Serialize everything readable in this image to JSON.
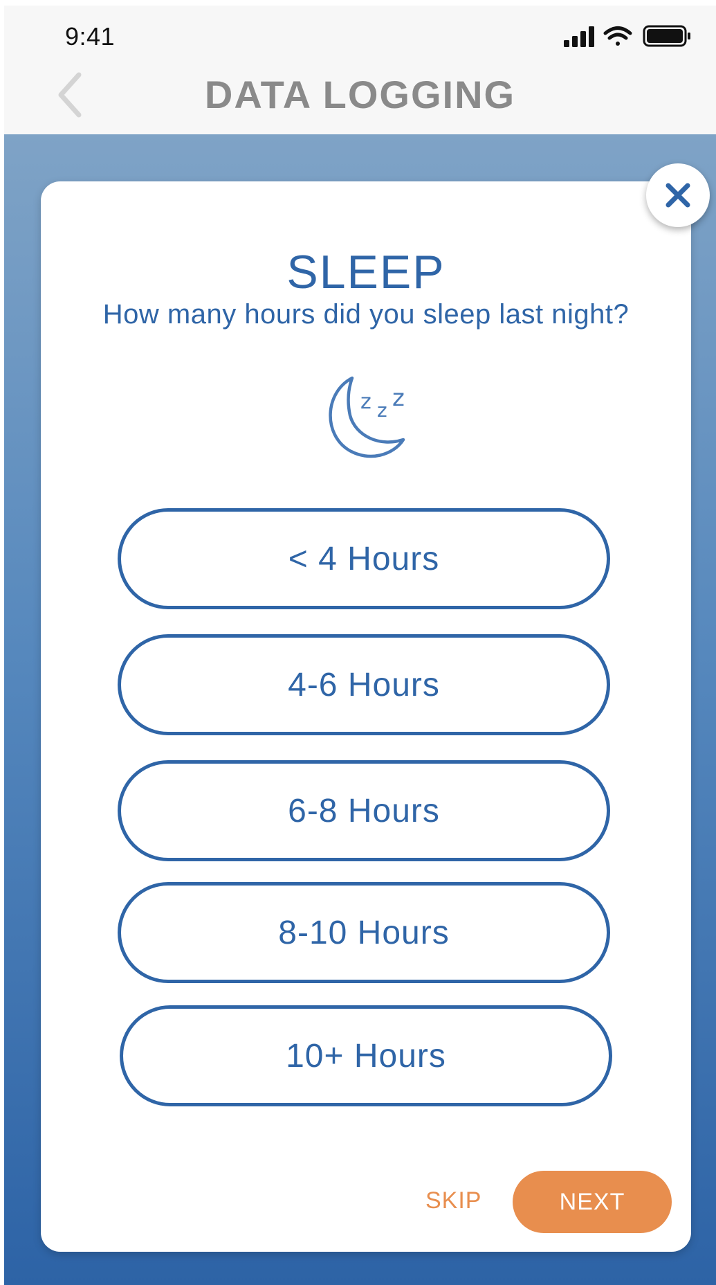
{
  "status_bar": {
    "time": "9:41",
    "icons": [
      "cellular-signal-icon",
      "wifi-icon",
      "battery-icon"
    ]
  },
  "nav": {
    "back_icon": "chevron-left-icon",
    "title": "DATA LOGGING"
  },
  "modal": {
    "close_icon": "close-icon",
    "title": "SLEEP",
    "subtitle": "How many hours did you sleep last night?",
    "illustration_icon": "sleeping-moon-icon",
    "options": [
      {
        "label": "< 4 Hours"
      },
      {
        "label": "4-6 Hours"
      },
      {
        "label": "6-8 Hours"
      },
      {
        "label": "8-10 Hours"
      },
      {
        "label": "10+ Hours"
      }
    ],
    "skip_label": "SKIP",
    "next_label": "NEXT"
  },
  "colors": {
    "primary_blue": "#2f65a7",
    "accent_orange": "#e88e4e",
    "nav_title_gray": "#8a8a8a",
    "gradient_top": "#7fa3c6",
    "gradient_bottom": "#2d63a6"
  }
}
